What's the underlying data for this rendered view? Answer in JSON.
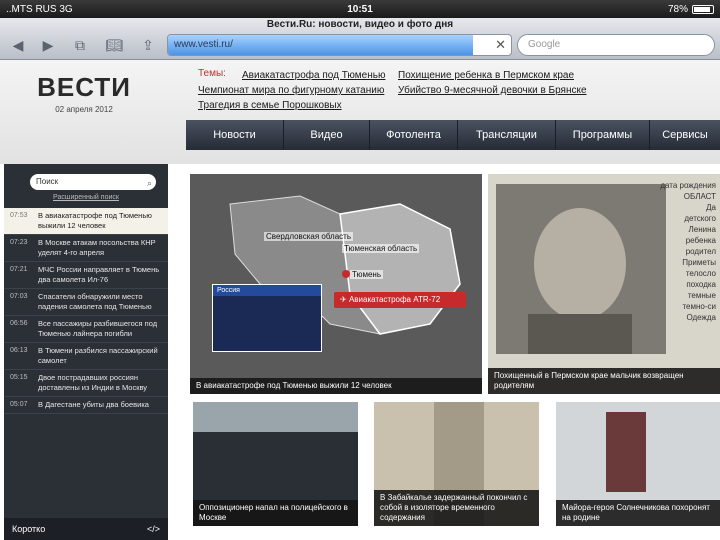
{
  "status_bar": {
    "carrier": "..MTS RUS 3G",
    "time": "10:51",
    "battery": "78%"
  },
  "browser": {
    "page_title": "Вести.Ru: новости, видео и фото дня",
    "url": "www.vesti.ru/",
    "search_placeholder": "Google",
    "load_progress": 0.89
  },
  "header": {
    "logo": "ВЕСТИ",
    "date": "02 апреля 2012",
    "topics_label": "Темы:",
    "topics": [
      "Авиакатастрофа под Тюменью",
      "Похищение ребенка в Пермском крае",
      "Чемпионат мира по фигурному катанию",
      "Убийство 9-месячной девочки в Брянске",
      "Трагедия в семье Порошковых"
    ],
    "nav": [
      "Новости",
      "Видео",
      "Фотолента",
      "Трансляции",
      "Программы",
      "Сервисы"
    ]
  },
  "sidebar": {
    "search_placeholder": "Поиск",
    "advanced_search": "Расширенный поиск",
    "news": [
      {
        "time": "07:53",
        "text": "В авиакатастрофе под Тюменью выжили 12 человек"
      },
      {
        "time": "07:23",
        "text": "В Москве атакам посольства КНР уделят 4-го апреля"
      },
      {
        "time": "07:21",
        "text": "МЧС России направляет в Тюмень два самолета Ил-76"
      },
      {
        "time": "07:03",
        "text": "Спасатели обнаружили место падения самолета под Тюменью"
      },
      {
        "time": "06:56",
        "text": "Все пассажиры разбившегося под Тюменью лайнера погибли"
      },
      {
        "time": "06:13",
        "text": "В Тюмени разбился пассажирский самолет"
      },
      {
        "time": "05:15",
        "text": "Двое пострадавших россиян доставлены из Индии в Москву"
      },
      {
        "time": "05:07",
        "text": "В Дагестане убиты два боевика"
      }
    ],
    "footer_left": "Коротко",
    "footer_right": "</>"
  },
  "tiles": {
    "map": {
      "caption": "В авиакатастрофе под Тюменью выжили 12 человек",
      "labels": [
        "Свердловская область",
        "Тюменская область",
        "Тюмень",
        "Россия"
      ],
      "tag": "Авиакатастрофа ATR-72"
    },
    "boy": {
      "caption": "Похищенный в Пермском крае мальчик возвращен родителям",
      "doc_text": "дата рождения\nОБЛАСТ\nДа\nдетского\nЛенина\nребенка\nродител\nПриметы\nтелосло\nпоходка\nтемные\nтемно-си\nОдежда"
    },
    "police": {
      "caption": "Оппозиционер напал на полицейского в Москве"
    },
    "hand": {
      "caption": "В Забайкалье задержанный покончил с собой в изоляторе временного содержания"
    },
    "flowers": {
      "caption": "Майора-героя Солнечникова похоронят на родине"
    }
  }
}
